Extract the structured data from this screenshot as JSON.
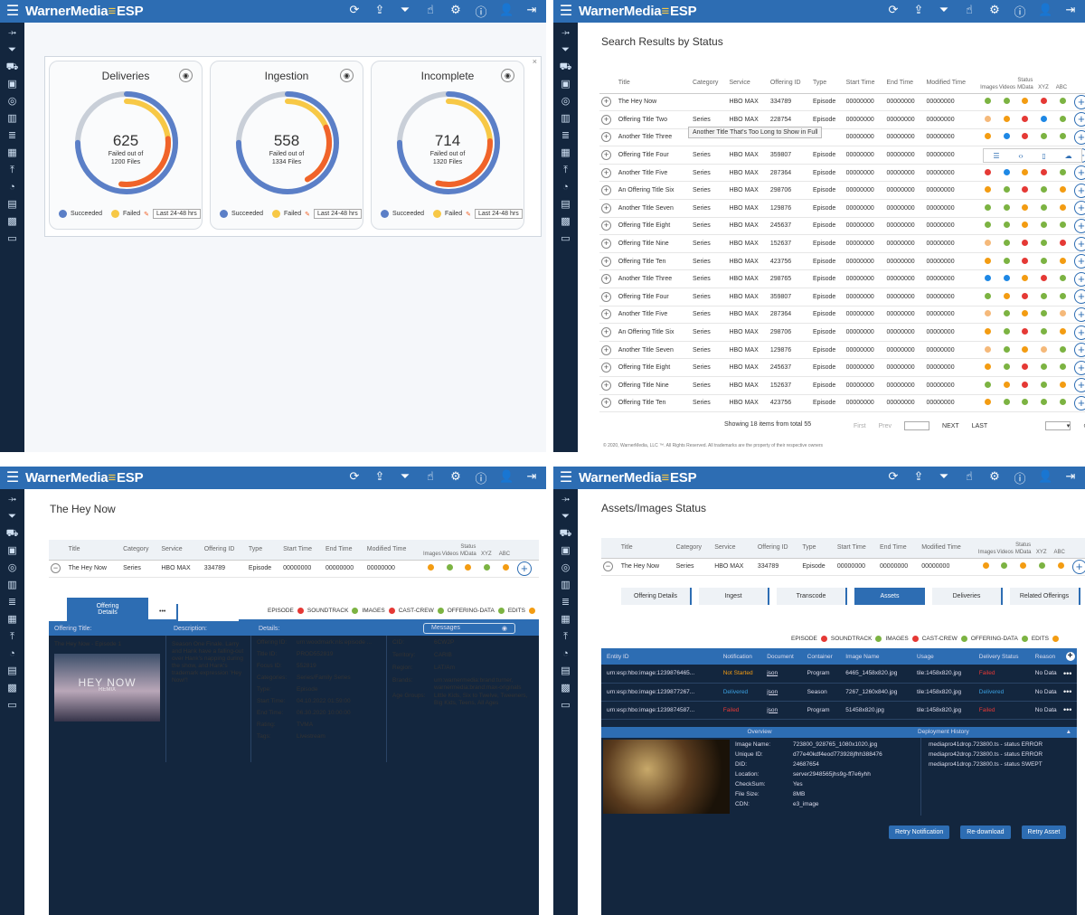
{
  "app": {
    "brand": "WarnerMedia",
    "brand_suffix": "ESP"
  },
  "colors": {
    "primary": "#2d6db3",
    "succeeded": "#5b7fc7",
    "failed": "#f7c846",
    "dark": "#13263e",
    "red": "#e53935",
    "green": "#7cb342",
    "orange": "#f39c12",
    "blue": "#1e88e5",
    "peach": "#f5b97a"
  },
  "q1": {
    "cards": [
      {
        "title": "Deliveries",
        "count": "625",
        "sub1": "Failed out of",
        "sub2": "1200 Files",
        "success": "Succeeded",
        "failed": "Failed",
        "range": "Last 24-48 hrs",
        "value": 0.52
      },
      {
        "title": "Ingestion",
        "count": "558",
        "sub1": "Failed out of",
        "sub2": "1334 Files",
        "success": "Succeeded",
        "failed": "Failed",
        "range": "Last 24-48 hrs",
        "value": 0.42
      },
      {
        "title": "Incomplete",
        "count": "714",
        "sub1": "Failed out of",
        "sub2": "1320 Files",
        "success": "Succeeded",
        "failed": "Failed",
        "range": "Last 24-48 hrs",
        "value": 0.54
      }
    ]
  },
  "q2": {
    "title": "Search Results by Status",
    "headers": [
      "Title",
      "Category",
      "Service",
      "Offering ID",
      "Type",
      "Start Time",
      "End Time",
      "Modified Time"
    ],
    "status_label": "Status",
    "status_cols": [
      "Images",
      "Videos",
      "MData",
      "XYZ",
      "ABC"
    ],
    "rows": [
      [
        "The Hey Now",
        "",
        "HBO MAX",
        "334789",
        "Episode",
        "00000000",
        "00000000",
        "00000000"
      ],
      [
        "Offering Title Two",
        "Series",
        "HBO MAX",
        "228754",
        "Episode",
        "00000000",
        "00000000",
        "00000000"
      ],
      [
        "Another Title Three",
        "",
        "",
        "",
        "",
        "00000000",
        "00000000",
        "00000000"
      ],
      [
        "Offering Title Four",
        "Series",
        "HBO MAX",
        "359807",
        "Episode",
        "00000000",
        "00000000",
        "00000000"
      ],
      [
        "Another Title Five",
        "Series",
        "HBO MAX",
        "287364",
        "Episode",
        "00000000",
        "00000000",
        "00000000"
      ],
      [
        "An Offering Title Six",
        "Series",
        "HBO MAX",
        "298706",
        "Episode",
        "00000000",
        "00000000",
        "00000000"
      ],
      [
        "Another Title Seven",
        "Series",
        "HBO MAX",
        "129876",
        "Episode",
        "00000000",
        "00000000",
        "00000000"
      ],
      [
        "Offering Title Eight",
        "Series",
        "HBO MAX",
        "245637",
        "Episode",
        "00000000",
        "00000000",
        "00000000"
      ],
      [
        "Offering Title Nine",
        "Series",
        "HBO MAX",
        "152637",
        "Episode",
        "00000000",
        "00000000",
        "00000000"
      ],
      [
        "Offering Title Ten",
        "Series",
        "HBO MAX",
        "423756",
        "Episode",
        "00000000",
        "00000000",
        "00000000"
      ],
      [
        "Another Title Three",
        "Series",
        "HBO MAX",
        "298765",
        "Episode",
        "00000000",
        "00000000",
        "00000000"
      ],
      [
        "Offering Title Four",
        "Series",
        "HBO MAX",
        "359807",
        "Episode",
        "00000000",
        "00000000",
        "00000000"
      ],
      [
        "Another Title Five",
        "Series",
        "HBO MAX",
        "287364",
        "Episode",
        "00000000",
        "00000000",
        "00000000"
      ],
      [
        "An Offering Title Six",
        "Series",
        "HBO MAX",
        "298706",
        "Episode",
        "00000000",
        "00000000",
        "00000000"
      ],
      [
        "Another Title Seven",
        "Series",
        "HBO MAX",
        "129876",
        "Episode",
        "00000000",
        "00000000",
        "00000000"
      ],
      [
        "Offering Title Eight",
        "Series",
        "HBO MAX",
        "245637",
        "Episode",
        "00000000",
        "00000000",
        "00000000"
      ],
      [
        "Offering Title Nine",
        "Series",
        "HBO MAX",
        "152637",
        "Episode",
        "00000000",
        "00000000",
        "00000000"
      ],
      [
        "Offering Title Ten",
        "Series",
        "HBO MAX",
        "423756",
        "Episode",
        "00000000",
        "00000000",
        "00000000"
      ]
    ],
    "dots": [
      [
        "green",
        "green",
        "orange",
        "red",
        "green"
      ],
      [
        "peach",
        "orange",
        "red",
        "blue",
        "green"
      ],
      [
        "orange",
        "blue",
        "red",
        "green",
        "green"
      ],
      [
        "green",
        "green",
        "orange",
        "green",
        "green"
      ],
      [
        "red",
        "blue",
        "orange",
        "red",
        "green"
      ],
      [
        "orange",
        "green",
        "red",
        "green",
        "orange"
      ],
      [
        "green",
        "green",
        "orange",
        "green",
        "orange"
      ],
      [
        "green",
        "green",
        "orange",
        "green",
        "green"
      ],
      [
        "peach",
        "green",
        "red",
        "green",
        "red"
      ],
      [
        "orange",
        "green",
        "red",
        "green",
        "orange"
      ],
      [
        "blue",
        "blue",
        "orange",
        "red",
        "green"
      ],
      [
        "green",
        "orange",
        "red",
        "green",
        "green"
      ],
      [
        "peach",
        "green",
        "orange",
        "green",
        "peach"
      ],
      [
        "orange",
        "green",
        "red",
        "green",
        "orange"
      ],
      [
        "peach",
        "green",
        "orange",
        "peach",
        "green"
      ],
      [
        "orange",
        "green",
        "red",
        "green",
        "green"
      ],
      [
        "green",
        "orange",
        "red",
        "green",
        "orange"
      ],
      [
        "orange",
        "green",
        "green",
        "green",
        "green"
      ]
    ],
    "tooltip": "Another Title That's Too Long to Show in Full",
    "showing": "Showing 18 items from total 55",
    "first": "First",
    "prev": "Prev",
    "next": "NEXT",
    "last": "LAST",
    "footer": "© 2020, WarnerMedia, LLC ™. All Rights Reserved. All trademarks are the property of their respective owners"
  },
  "q3": {
    "title": "The Hey Now",
    "headers": [
      "Title",
      "Category",
      "Service",
      "Offering ID",
      "Type",
      "Start Time",
      "End Time",
      "Modified Time"
    ],
    "status_label": "Status",
    "status_cols": [
      "Images",
      "Videos",
      "MData",
      "XYZ",
      "ABC"
    ],
    "row": [
      "The Hey Now",
      "Series",
      "HBO MAX",
      "334789",
      "Episode",
      "00000000",
      "00000000",
      "00000000"
    ],
    "tab": "Offering Details",
    "more": "•••",
    "legend": [
      "EPISODE",
      "SOUNDTRACK",
      "IMAGES",
      "CAST-CREW",
      "OFFERING-DATA",
      "EDITS"
    ],
    "col_offering": "Offering Title:",
    "col_desc": "Description:",
    "col_details": "Details:",
    "messages": "Messages",
    "offering_title": "The Hey Now - Episode 1",
    "poster_title": "HEY NOW",
    "poster_sub": "REMIX",
    "description": "Season One Finale. Larry and Hank have a falling-out over Hank's napping during the show, and Hank's trademark expression 'Hey Now!'!",
    "details": [
      [
        "Offering ID:",
        "urn:woodmark:nls:episode ..."
      ],
      [
        "Title ID:",
        "PROD552819"
      ],
      [
        "Focus ID:",
        "552819"
      ],
      [
        "Categories:",
        "Series/Family Series"
      ],
      [
        "Type:",
        "Episode"
      ],
      [
        "Start Time:",
        "04.10.2022    01:59:00"
      ],
      [
        "End Time:",
        "06.30.2020    10:00:00"
      ],
      [
        "Rating:",
        "TVMA"
      ],
      [
        "Tags:",
        "Livestream"
      ]
    ],
    "extra": [
      [
        "CID:",
        "6CW2P"
      ],
      [
        "Territory:",
        "CARIB"
      ],
      [
        "Region:",
        "LAT/Am"
      ],
      [
        "Brands:",
        "urn:warnermedia:brand:turner, warnermedia:brand:max-originals"
      ],
      [
        "Age Groups:",
        "Little Kids, Six to Twelve, Tweeners, Big Kids, Teens, All Ages"
      ]
    ]
  },
  "q4": {
    "title": "Assets/Images Status",
    "headers": [
      "Title",
      "Category",
      "Service",
      "Offering ID",
      "Type",
      "Start Time",
      "End Time",
      "Modified Time"
    ],
    "status_label": "Status",
    "status_cols": [
      "Images",
      "Videos",
      "MData",
      "XYZ",
      "ABC"
    ],
    "row": [
      "The Hey Now",
      "Series",
      "HBO MAX",
      "334789",
      "Episode",
      "00000000",
      "00000000",
      "00000000"
    ],
    "tabs": [
      "Offering Details",
      "Ingest",
      "Transcode",
      "Assets",
      "Deliveries",
      "Related Offerings"
    ],
    "legend": [
      "EPISODE",
      "SOUNDTRACK",
      "IMAGES",
      "CAST-CREW",
      "OFFERING-DATA",
      "EDITS"
    ],
    "asset_headers": [
      "Entity ID",
      "Notification",
      "Document",
      "Container",
      "Image Name",
      "Usage",
      "Delivery Status",
      "Reason"
    ],
    "asset_rows": [
      [
        "urn:esp:hbo:image:1239876465...",
        "Not Started",
        "json",
        "Program",
        "6465_1458x820.jpg",
        "tile:1458x820.jpg",
        "Failed",
        "No Data"
      ],
      [
        "urn:esp:hbo:image:1239877267...",
        "Delivered",
        "json",
        "Season",
        "7267_1260x840.jpg",
        "tile:1458x820.jpg",
        "Delivered",
        "No Data"
      ],
      [
        "urn:esp:hbo:image:1239874587...",
        "Failed",
        "json",
        "Program",
        "51458x820.jpg",
        "tile:1458x820.jpg",
        "Failed",
        "No Data"
      ]
    ],
    "overview": "Overview",
    "deploy": "Deployment History",
    "img_fields": [
      [
        "Image Name:",
        "723800_928765_1080x1020.jpg"
      ],
      [
        "Unique ID:",
        "d77e40kdf4eod773928jfhh388476"
      ],
      [
        "DID:",
        "24687654"
      ],
      [
        "Location:",
        "server2948565jhs9g-ff7e6yhh"
      ],
      [
        "CheckSum:",
        "Yes"
      ],
      [
        "File Size:",
        "8MB"
      ],
      [
        "CDN:",
        "e3_image"
      ]
    ],
    "history": [
      "mediapro41drop.723800.ts - status ERROR",
      "mediapro42drop.723800.ts - status ERROR",
      "mediapro41drop.723800.ts - status SWEPT"
    ],
    "buttons": [
      "Retry Notification",
      "Re-download",
      "Retry Asset"
    ]
  }
}
